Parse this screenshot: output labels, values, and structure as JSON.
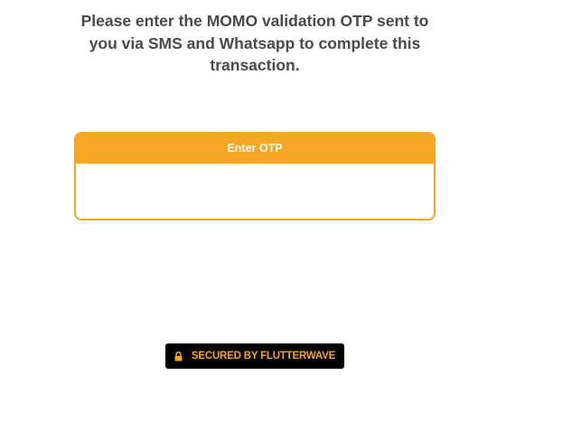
{
  "instruction": {
    "text": "Please enter the MOMO validation OTP sent to you via SMS and Whatsapp to complete this transaction."
  },
  "otp": {
    "header_label": "Enter OTP",
    "value": "",
    "placeholder": ""
  },
  "secure_badge": {
    "text": "SECURED BY FLUTTERWAVE",
    "icon": "lock-icon"
  },
  "colors": {
    "accent": "#f5a623",
    "text": "#4a4a4a",
    "badge_background": "#000000"
  }
}
